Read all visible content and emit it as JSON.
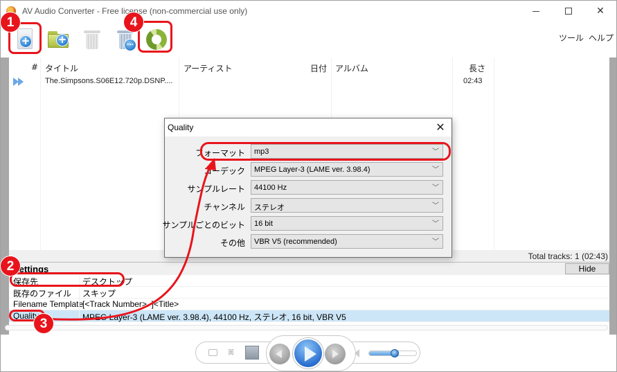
{
  "window": {
    "title": "AV Audio Converter - Free license (non-commercial use only)",
    "controls": {
      "minimize": "minimize",
      "maximize": "maximize",
      "close": "✕"
    }
  },
  "toolbar": {
    "buttons": [
      {
        "name": "add-files",
        "icon": "add-file-icon"
      },
      {
        "name": "add-folder",
        "icon": "add-folder-icon"
      },
      {
        "name": "delete",
        "icon": "trash-icon"
      },
      {
        "name": "delete-all",
        "icon": "trash-more-icon"
      },
      {
        "name": "convert",
        "icon": "convert-icon"
      }
    ],
    "menu": {
      "tools": "ツール",
      "help": "ヘルプ"
    }
  },
  "tracklist": {
    "columns": [
      "#",
      "タイトル",
      "アーティスト",
      "日付",
      "アルバム",
      "長さ"
    ],
    "rows": [
      {
        "number": "",
        "title": "The.Simpsons.S06E12.720p.DSNP....",
        "artist": "",
        "date": "",
        "album": "",
        "length": "02:43",
        "playing": true
      }
    ],
    "total": "Total tracks: 1 (02:43)"
  },
  "settings": {
    "title": "Settings",
    "hide_label": "Hide",
    "rows": [
      {
        "key": "保存先",
        "value": "デスクトップ"
      },
      {
        "key": "既存のファイル",
        "value": "スキップ"
      },
      {
        "key": "Filename Template",
        "value": "[<Track Number>. ]<Title>"
      },
      {
        "key": "Quality",
        "value": "MPEG Layer-3 (LAME ver. 3.98.4), 44100 Hz, ステレオ, 16 bit, VBR V5",
        "selected": true
      }
    ]
  },
  "player": {
    "volume_percent": 55,
    "buttons": [
      "subtitle",
      "effects",
      "stop",
      "previous",
      "play",
      "next",
      "volume"
    ]
  },
  "dialog": {
    "title": "Quality",
    "close": "✕",
    "fields": [
      {
        "label": "フォーマット",
        "value": "mp3"
      },
      {
        "label": "コーデック",
        "value": "MPEG Layer-3 (LAME ver. 3.98.4)"
      },
      {
        "label": "サンプルレート",
        "value": "44100 Hz"
      },
      {
        "label": "チャンネル",
        "value": "ステレオ"
      },
      {
        "label": "サンプルごとのビット",
        "value": "16 bit"
      },
      {
        "label": "その他",
        "value": "VBR V5 (recommended)"
      }
    ],
    "chevron": "﹀"
  },
  "annotations": {
    "color": "#e8141c",
    "markers": [
      "1",
      "2",
      "3",
      "4"
    ]
  }
}
